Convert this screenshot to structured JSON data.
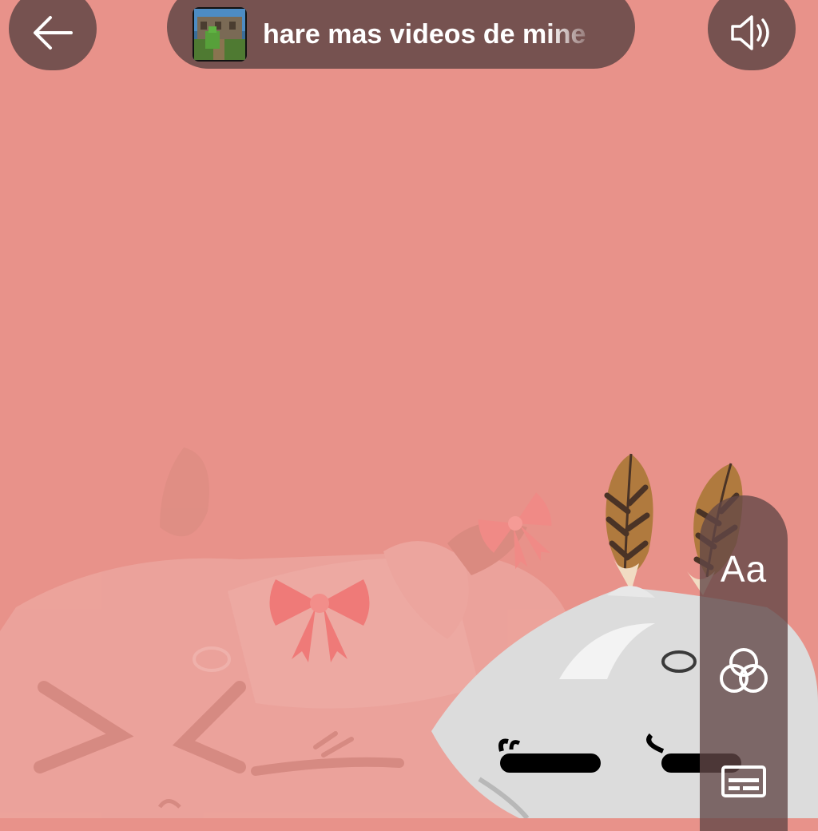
{
  "header": {
    "back_icon": "arrow-left-icon",
    "title": "hare mas videos de mine",
    "thumbnail": "minecraft-video-thumbnail",
    "sound_icon": "speaker-volume-icon"
  },
  "tools": {
    "text_label": "Aa",
    "filter_icon": "three-circles-filter-icon",
    "caption_icon": "captions-icon"
  },
  "colors": {
    "background": "#e8928a",
    "controls": "#765250",
    "icon": "#ffffff"
  }
}
